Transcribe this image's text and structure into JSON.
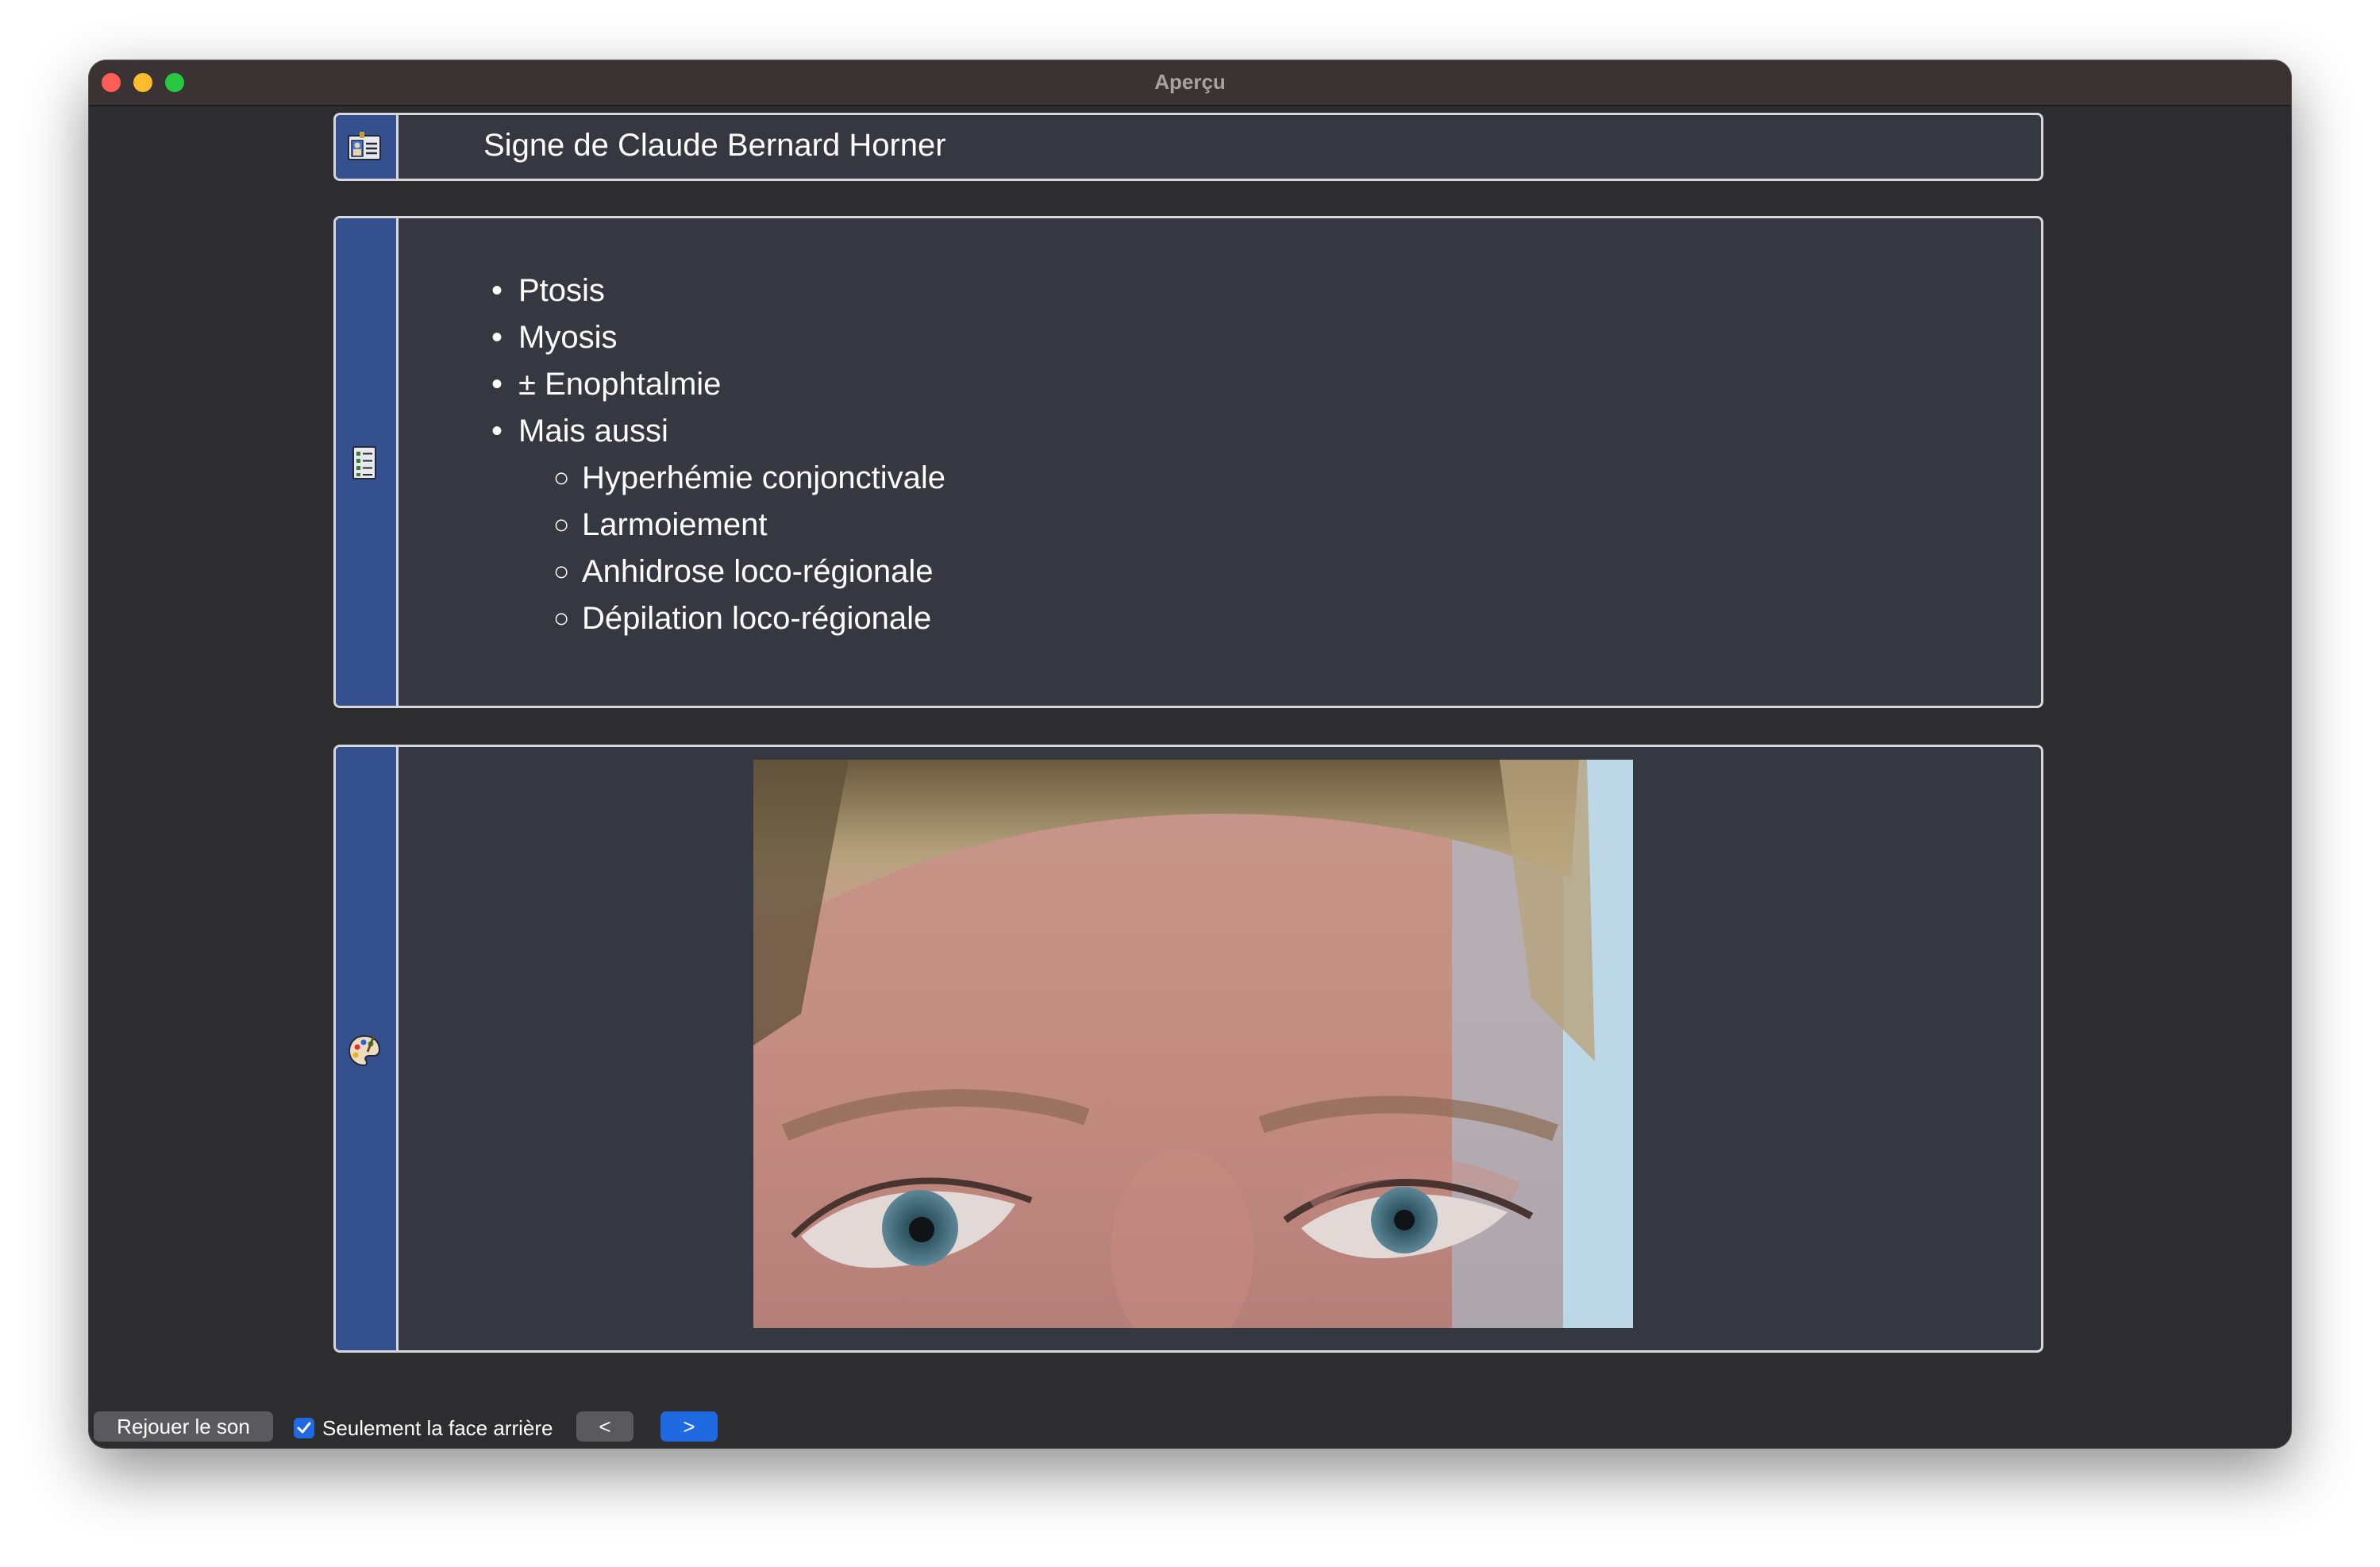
{
  "window": {
    "title": "Aperçu"
  },
  "title_card": {
    "title": "Signe de Claude Bernard Horner"
  },
  "list_card": {
    "items": [
      {
        "text": "Ptosis",
        "level": 1
      },
      {
        "text": "Myosis",
        "level": 1
      },
      {
        "text": "± Enophtalmie",
        "level": 1
      },
      {
        "text": "Mais aussi",
        "level": 1
      },
      {
        "text": "Hyperhémie conjonctivale",
        "level": 2
      },
      {
        "text": "Larmoiement",
        "level": 2
      },
      {
        "text": "Anhidrose loco-régionale",
        "level": 2
      },
      {
        "text": "Dépilation loco-régionale",
        "level": 2
      }
    ]
  },
  "image_card": {
    "icon": "palette-icon"
  },
  "bottom": {
    "replay_label": "Rejouer le son",
    "checkbox_label": "Seulement la face arrière",
    "checkbox_checked": true,
    "prev_label": "<",
    "next_label": ">"
  },
  "colors": {
    "strip": "#34508f",
    "card_bg": "#363841",
    "window_bg": "#2d2d2f",
    "accent": "#1f6ae0"
  }
}
